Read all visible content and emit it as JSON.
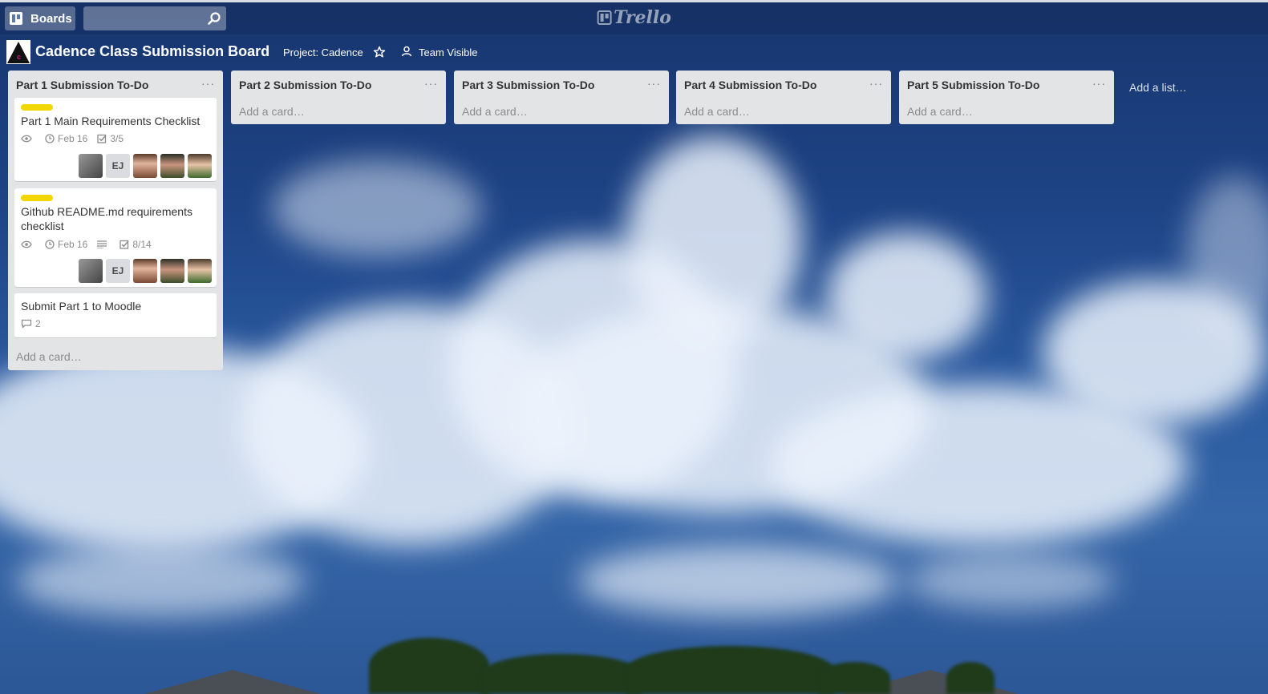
{
  "header": {
    "boards_label": "Boards",
    "search_value": "",
    "logo_text": "Trello"
  },
  "board": {
    "title": "Cadence Class Submission Board",
    "project": "Project: Cadence",
    "visibility": "Team Visible"
  },
  "lists": [
    {
      "title": "Part 1 Submission To-Do",
      "menu": "···",
      "add_card": "Add a card…",
      "cards": [
        {
          "title": "Part 1 Main Requirements Checklist",
          "label_color": "#f2d600",
          "due": "Feb 16",
          "checklist": "3/5",
          "members": [
            "photo-1",
            "EJ",
            "photo-2",
            "photo-3",
            "photo-4"
          ]
        },
        {
          "title": "Github README.md requirements checklist",
          "label_color": "#f2d600",
          "due": "Feb 16",
          "checklist": "8/14",
          "members": [
            "photo-1",
            "EJ",
            "photo-2",
            "photo-3",
            "photo-4"
          ]
        },
        {
          "title": "Submit Part 1 to Moodle",
          "comments": "2"
        }
      ]
    },
    {
      "title": "Part 2 Submission To-Do",
      "menu": "···",
      "add_card": "Add a card…"
    },
    {
      "title": "Part 3 Submission To-Do",
      "menu": "···",
      "add_card": "Add a card…"
    },
    {
      "title": "Part 4 Submission To-Do",
      "menu": "···",
      "add_card": "Add a card…"
    },
    {
      "title": "Part 5 Submission To-Do",
      "menu": "···",
      "add_card": "Add a card…"
    }
  ],
  "add_list": "Add a list…",
  "icons": {
    "boards": "boards-icon",
    "search": "search-icon",
    "star": "star-icon",
    "team": "team-icon",
    "watch": "eye-icon",
    "due": "clock-icon",
    "checklist": "checkbox-icon",
    "description": "description-icon",
    "comments": "comment-icon"
  },
  "colors": {
    "label_yellow": "#f2d600",
    "list_bg": "#e2e4e6"
  }
}
